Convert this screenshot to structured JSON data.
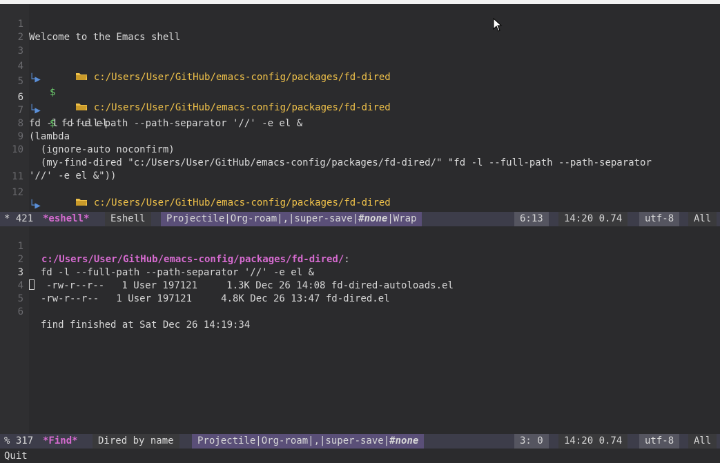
{
  "top_window": {
    "lines": [
      {
        "num": "1",
        "text": "Welcome to the Emacs shell"
      },
      {
        "num": "2",
        "text": ""
      },
      {
        "num": "3",
        "path": "c:/Users/User/GitHub/emacs-config/packages/fd-dired"
      },
      {
        "num": "4",
        "prompt": "$",
        "cmd": ""
      },
      {
        "num": "5",
        "path": "c:/Users/User/GitHub/emacs-config/packages/fd-dired"
      },
      {
        "num": "6",
        "prompt": "$",
        "cmd": " fd -e el"
      },
      {
        "num": "7",
        "text": "fd -l --full-path --path-separator '//' -e el &"
      },
      {
        "num": "8",
        "text": "(lambda"
      },
      {
        "num": "9",
        "text": "  (ignore-auto noconfirm)"
      },
      {
        "num": "10",
        "text": "  (my-find-dired \"c:/Users/User/GitHub/emacs-config/packages/fd-dired/\" \"fd -l --full-path --path-separator"
      },
      {
        "num": "",
        "text": "'//' -e el &\"))"
      },
      {
        "num": "11",
        "path": "c:/Users/User/GitHub/emacs-config/packages/fd-dired"
      },
      {
        "num": "12",
        "prompt": "$",
        "cmd": ""
      }
    ],
    "prompt_arrow": "└▶"
  },
  "top_modeline": {
    "lead": "* 421 ",
    "buffer": "*eshell*",
    "major_mode": "Eshell",
    "minor_modes_a": "Projectile|Org-roam|,|super-save|",
    "minor_none": "#none",
    "minor_modes_b": "|Wrap",
    "position": "6:13",
    "time": "14:20 0.74",
    "encoding": "utf-8",
    "scroll": "All"
  },
  "bottom_window": {
    "lines": [
      {
        "num": "1",
        "dired_path": "c:/Users/User/GitHub/emacs-config/packages/fd-dired/",
        "suffix": ":"
      },
      {
        "num": "2",
        "text": "  fd -l --full-path --path-separator '//' -e el &"
      },
      {
        "num": "3",
        "text": "-rw-r--r--   1 User 197121     1.3K Dec 26 14:08 fd-dired-autoloads.el",
        "cursor": true
      },
      {
        "num": "4",
        "text": "  -rw-r--r--   1 User 197121     4.8K Dec 26 13:47 fd-dired.el"
      },
      {
        "num": "5",
        "text": ""
      },
      {
        "num": "6",
        "text": "  find finished at Sat Dec 26 14:19:34"
      }
    ]
  },
  "bottom_modeline": {
    "lead": "% 317 ",
    "buffer": "*Find*",
    "major_mode": "Dired by name",
    "minor_modes_a": "Projectile|Org-roam|,|super-save|",
    "minor_none": "#none",
    "position": "3: 0",
    "time": "14:20 0.74",
    "encoding": "utf-8",
    "scroll": "All"
  },
  "minibuffer": {
    "message": "Quit"
  },
  "colors": {
    "background": "#2b2b2d",
    "prompt_path": "#f0c24a",
    "prompt_dollar": "#6fd16f",
    "dired_header": "#d66bd0",
    "modeline": "#3d3d4a"
  }
}
